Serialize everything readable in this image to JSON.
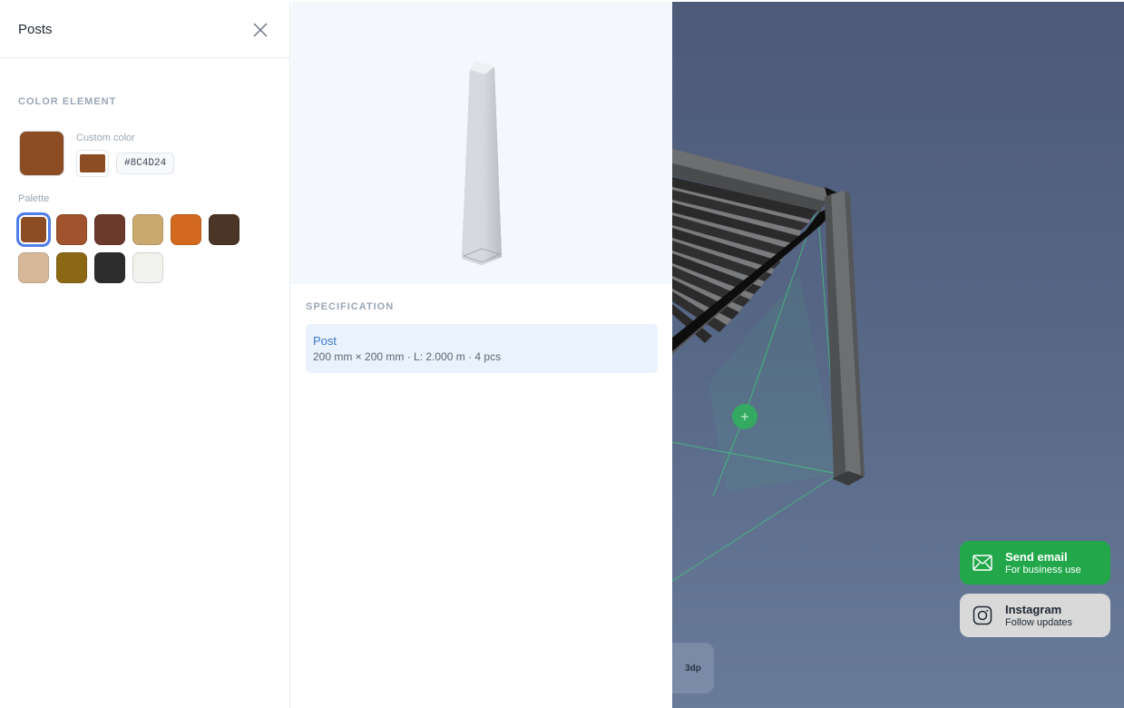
{
  "panel": {
    "title": "Posts",
    "close_icon": "close-icon"
  },
  "color_element": {
    "section_label": "COLOR ELEMENT",
    "current_color": "#8C4D24",
    "custom_label": "Custom color",
    "hex_value": "#8C4D24",
    "palette_label": "Palette",
    "palette": [
      "#8C4D24",
      "#A0532C",
      "#6B3A2A",
      "#C9A96E",
      "#D2691E",
      "#4A3526",
      "#D7B99A",
      "#8B6914",
      "#2D2D2D",
      "#F2F2EE"
    ],
    "selected_index": 0
  },
  "specification": {
    "section_label": "SPECIFICATION",
    "item_name": "Post",
    "item_detail": "200 mm × 200 mm ·  L: 2.000 m · 4 pcs"
  },
  "viewport": {
    "view_chip": "3dp"
  },
  "contact": {
    "email_title": "Send email",
    "email_subtitle": "For business use",
    "email_icon": "mail-icon",
    "instagram_title": "Instagram",
    "instagram_subtitle": "Follow updates",
    "instagram_icon": "instagram-icon"
  }
}
